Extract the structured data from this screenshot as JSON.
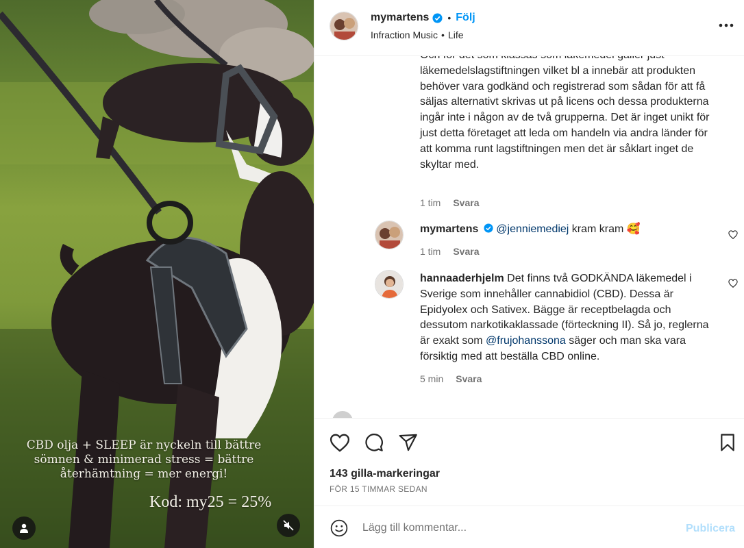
{
  "media": {
    "caption_lines": [
      "CBD olja + SLEEP är nyckeln till bättre",
      "sömnen & minimerad stress = bättre",
      "återhämtning = mer energi!"
    ],
    "code_text": "Kod: my25 = 25%",
    "tag_icon": "user-tag-icon",
    "mute_icon": "speaker-muted-icon"
  },
  "header": {
    "username": "mymartens",
    "dot": "•",
    "follow_label": "Följ",
    "audio": "Infraction Music",
    "sep": "•",
    "category": "Life",
    "more_icon": "more-horizontal-icon"
  },
  "comments": [
    {
      "text": "Och för det som klassas som läkemedel gäller just läkemedelslagstiftningen vilket bl a innebär att produkten behöver vara godkänd och registrerad som sådan för att få säljas alternativt skrivas ut på licens och dessa produkterna ingår inte i någon av de två grupperna. Det är inget unikt för just detta företaget att leda om handeln via andra länder för att komma runt lagstiftningen men det är såklart inget de skyltar med.",
      "time": "1 tim",
      "reply_label": "Svara"
    },
    {
      "user": "mymartens",
      "mention": "@jenniemediej",
      "text": " kram kram 🥰",
      "time": "1 tim",
      "reply_label": "Svara"
    },
    {
      "user": "hannaaderhjelm",
      "text_before": " Det finns två GODKÄNDA läkemedel i Sverige som innehåller cannabidiol (CBD). Dessa är Epidyolex och Sativex. Bägge är receptbelagda och dessutom narkotikaklassade (förteckning II). Så jo, reglerna är exakt som ",
      "mention": "@frujohanssona",
      "text_after": " säger och man ska vara försiktig med att beställa CBD online.",
      "time": "5 min",
      "reply_label": "Svara"
    }
  ],
  "actions": {
    "icons": [
      "heart-icon",
      "comment-icon",
      "share-icon",
      "bookmark-icon"
    ],
    "likes": "143 gilla-markeringar",
    "time_ago": "FÖR 15 TIMMAR SEDAN"
  },
  "composer": {
    "placeholder": "Lägg till kommentar...",
    "publish_label": "Publicera"
  },
  "colors": {
    "link_blue": "#0095f6",
    "mention": "#00376b",
    "muted_text": "#737373",
    "publish_disabled": "#b2dffc"
  }
}
